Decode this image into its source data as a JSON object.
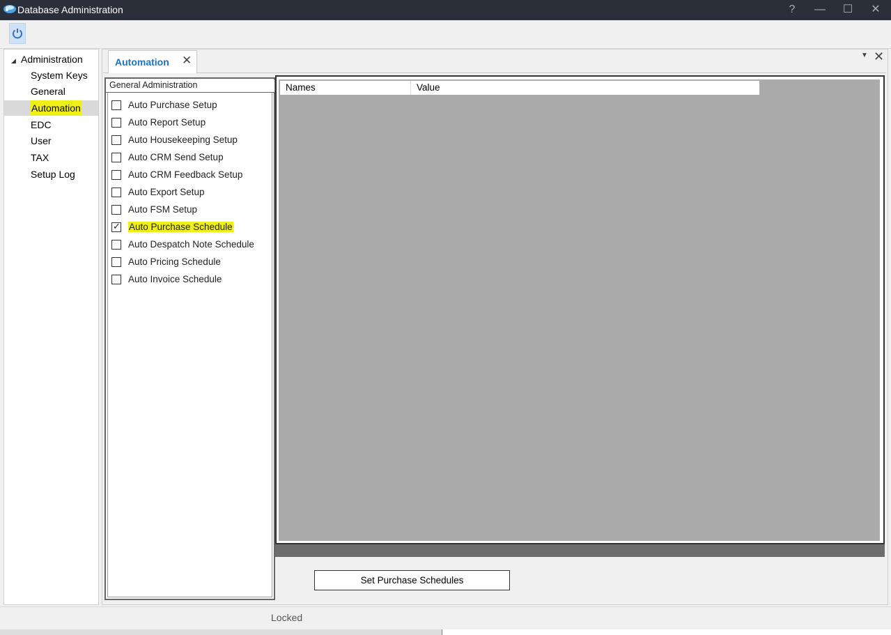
{
  "window": {
    "title": "Database Administration",
    "help_glyph": "?",
    "minimize_glyph": "—",
    "maximize_glyph": "☐",
    "close_glyph": "✕"
  },
  "toolbar": {
    "icons": [
      "power-icon"
    ]
  },
  "nav": {
    "root_label": "Administration",
    "root_arrow": "◢",
    "items": [
      {
        "label": "System Keys",
        "selected": false
      },
      {
        "label": "General",
        "selected": false
      },
      {
        "label": "Automation",
        "selected": true
      },
      {
        "label": "EDC",
        "selected": false
      },
      {
        "label": "User",
        "selected": false
      },
      {
        "label": "TAX",
        "selected": false
      },
      {
        "label": "Setup Log",
        "selected": false
      }
    ]
  },
  "tabs": [
    {
      "label": "Automation",
      "close_glyph": "✕",
      "active": true
    }
  ],
  "panel": {
    "menu_glyph": "▼",
    "close_glyph": "✕"
  },
  "general_admin": {
    "title": "General Administration",
    "items": [
      {
        "label": "Auto Purchase Setup",
        "checked": false
      },
      {
        "label": "Auto Report Setup",
        "checked": false
      },
      {
        "label": "Auto Housekeeping Setup",
        "checked": false
      },
      {
        "label": "Auto CRM Send Setup",
        "checked": false
      },
      {
        "label": "Auto CRM Feedback Setup",
        "checked": false
      },
      {
        "label": "Auto Export Setup",
        "checked": false
      },
      {
        "label": "Auto FSM Setup",
        "checked": false
      },
      {
        "label": "Auto Purchase Schedule",
        "checked": true
      },
      {
        "label": "Auto Despatch Note Schedule",
        "checked": false
      },
      {
        "label": "Auto Pricing Schedule",
        "checked": false
      },
      {
        "label": "Auto Invoice Schedule",
        "checked": false
      }
    ]
  },
  "grid": {
    "columns": [
      "Names",
      "Value"
    ]
  },
  "actions": {
    "set_schedules_label": "Set Purchase Schedules"
  },
  "status": {
    "text": "Locked"
  },
  "colors": {
    "titlebar": "#2b2f3a",
    "accent": "#1a73c8",
    "highlight": "#f0f016",
    "grid_bg": "#ababab"
  }
}
